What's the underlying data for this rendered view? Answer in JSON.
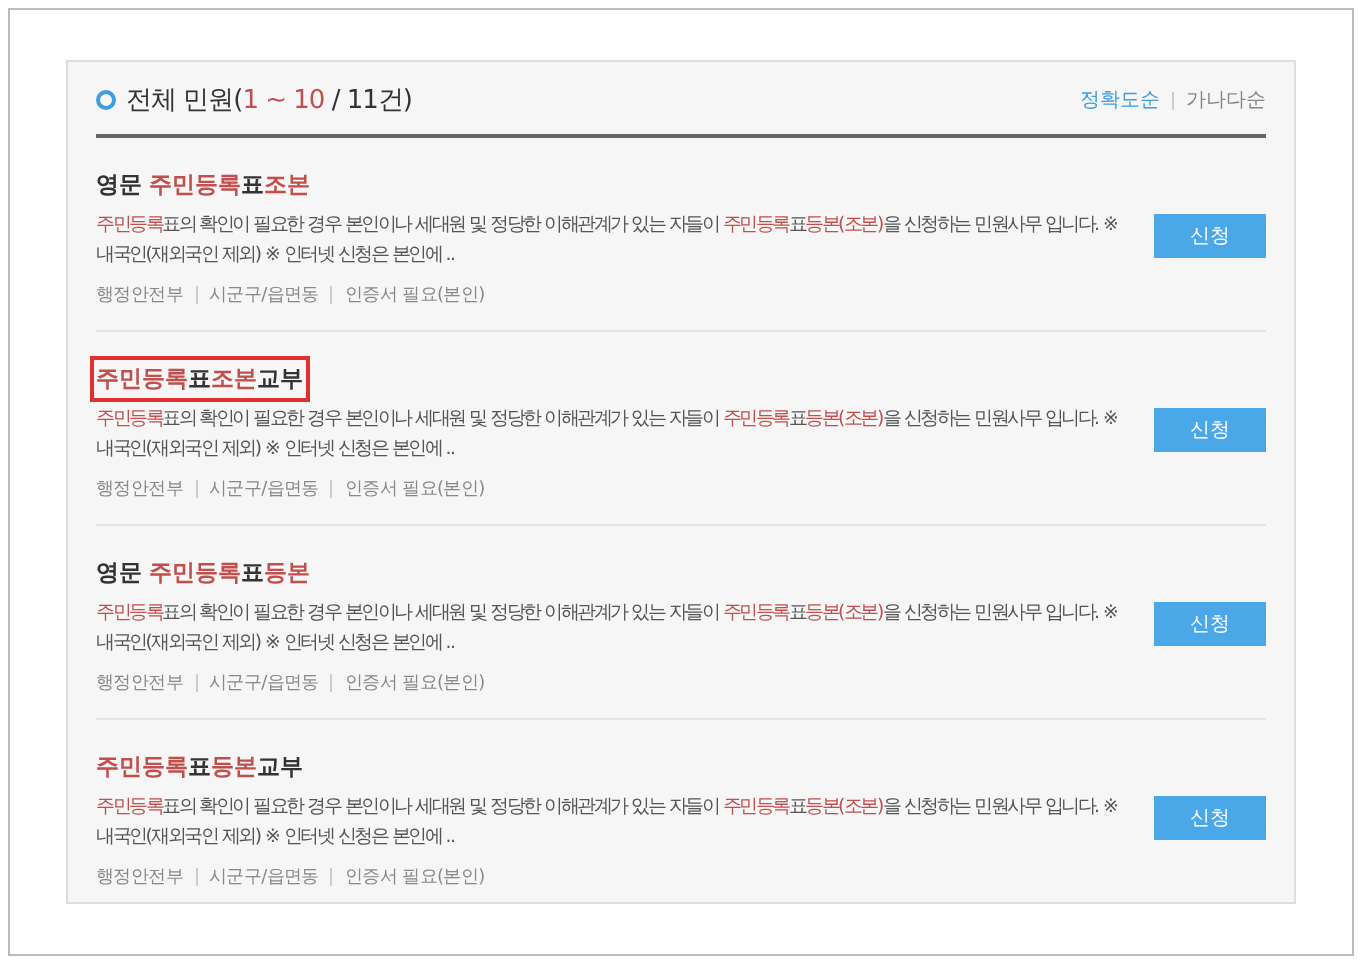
{
  "header": {
    "title": [
      {
        "text": "전체 민원(",
        "highlight": false
      },
      {
        "text": "1 ~ 10",
        "highlight": true
      },
      {
        "text": " / 11건)",
        "highlight": false
      }
    ]
  },
  "sort_options": [
    {
      "label": "정확도순",
      "selected": true
    },
    {
      "label": "가나다순",
      "selected": false
    }
  ],
  "results": [
    {
      "title": [
        {
          "text": "영문 ",
          "highlight": false
        },
        {
          "text": "주민등록",
          "highlight": true
        },
        {
          "text": "표",
          "highlight": false
        },
        {
          "text": "조본",
          "highlight": true
        }
      ],
      "outlined": false,
      "description": [
        {
          "text": "주민등록",
          "highlight": true
        },
        {
          "text": "표의 확인이 필요한 경우 본인이나 세대원 및 정당한 이해관계가 있는 자들이 ",
          "highlight": false
        },
        {
          "text": "주민등록",
          "highlight": true
        },
        {
          "text": "표",
          "highlight": false
        },
        {
          "text": "등본(조본)",
          "highlight": true
        },
        {
          "text": "을 신청하는 민원사무 입니다. ※ 내국인(재외국인 제외) ※ 인터넷 신청은 본인에 ..",
          "highlight": false
        }
      ],
      "meta": [
        "행정안전부",
        "시군구/읍면동",
        "인증서 필요(본인)"
      ],
      "button": "신청"
    },
    {
      "title": [
        {
          "text": "주민등록",
          "highlight": true
        },
        {
          "text": "표",
          "highlight": false
        },
        {
          "text": "조본",
          "highlight": true
        },
        {
          "text": "교부",
          "highlight": false
        }
      ],
      "outlined": true,
      "description": [
        {
          "text": "주민등록",
          "highlight": true
        },
        {
          "text": "표의 확인이 필요한 경우 본인이나 세대원 및 정당한 이해관계가 있는 자들이 ",
          "highlight": false
        },
        {
          "text": "주민등록",
          "highlight": true
        },
        {
          "text": "표",
          "highlight": false
        },
        {
          "text": "등본(조본)",
          "highlight": true
        },
        {
          "text": "을 신청하는 민원사무 입니다. ※ 내국인(재외국인 제외) ※ 인터넷 신청은 본인에 ..",
          "highlight": false
        }
      ],
      "meta": [
        "행정안전부",
        "시군구/읍면동",
        "인증서 필요(본인)"
      ],
      "button": "신청"
    },
    {
      "title": [
        {
          "text": "영문 ",
          "highlight": false
        },
        {
          "text": "주민등록",
          "highlight": true
        },
        {
          "text": "표",
          "highlight": false
        },
        {
          "text": "등본",
          "highlight": true
        }
      ],
      "outlined": false,
      "description": [
        {
          "text": "주민등록",
          "highlight": true
        },
        {
          "text": "표의 확인이 필요한 경우 본인이나 세대원 및 정당한 이해관계가 있는 자들이 ",
          "highlight": false
        },
        {
          "text": "주민등록",
          "highlight": true
        },
        {
          "text": "표",
          "highlight": false
        },
        {
          "text": "등본(조본)",
          "highlight": true
        },
        {
          "text": "을 신청하는 민원사무 입니다. ※ 내국인(재외국인 제외) ※ 인터넷 신청은 본인에 ..",
          "highlight": false
        }
      ],
      "meta": [
        "행정안전부",
        "시군구/읍면동",
        "인증서 필요(본인)"
      ],
      "button": "신청"
    },
    {
      "title": [
        {
          "text": "주민등록",
          "highlight": true
        },
        {
          "text": "표",
          "highlight": false
        },
        {
          "text": "등본",
          "highlight": true
        },
        {
          "text": "교부",
          "highlight": false
        }
      ],
      "outlined": false,
      "description": [
        {
          "text": "주민등록",
          "highlight": true
        },
        {
          "text": "표의 확인이 필요한 경우 본인이나 세대원 및 정당한 이해관계가 있는 자들이 ",
          "highlight": false
        },
        {
          "text": "주민등록",
          "highlight": true
        },
        {
          "text": "표",
          "highlight": false
        },
        {
          "text": "등본(조본)",
          "highlight": true
        },
        {
          "text": "을 신청하는 민원사무 입니다. ※ 내국인(재외국인 제외) ※ 인터넷 신청은 본인에 ..",
          "highlight": false
        }
      ],
      "meta": [
        "행정안전부",
        "시군구/읍면동",
        "인증서 필요(본인)"
      ],
      "button": "신청"
    }
  ]
}
